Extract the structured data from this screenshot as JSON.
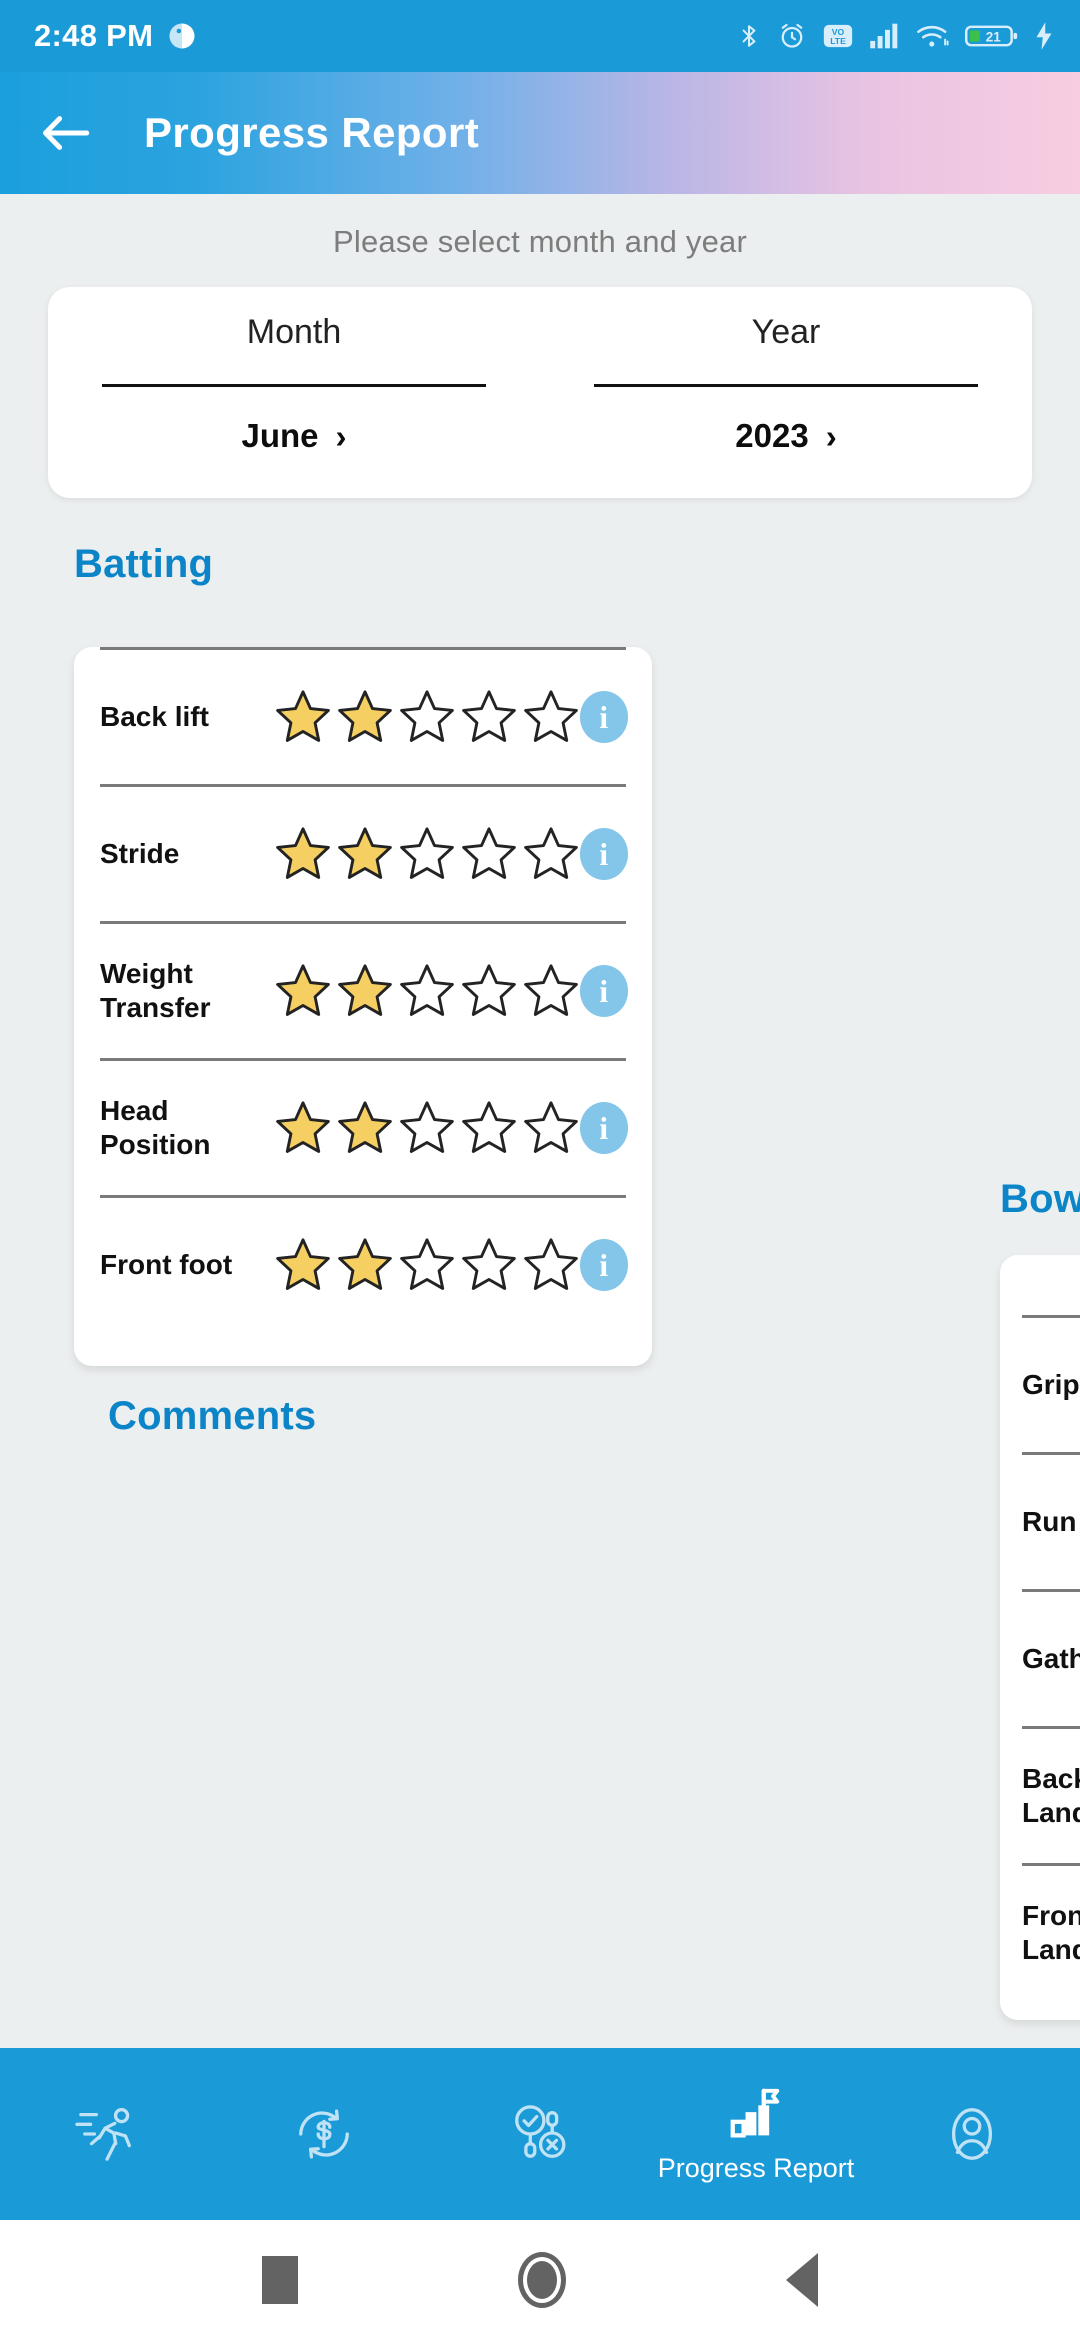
{
  "status_bar": {
    "time": "2:48 PM",
    "left_icons": [
      "weather-icon"
    ],
    "right_icons": [
      "bluetooth-icon",
      "alarm-icon",
      "volte-icon",
      "signal-icon",
      "wifi-icon",
      "battery-icon",
      "charging-icon"
    ],
    "battery_percent": "21"
  },
  "app_bar": {
    "back_icon": "arrow-left-icon",
    "title": "Progress Report",
    "gradient_start": "#1ba0dd",
    "gradient_end": "#f8cde1"
  },
  "picker": {
    "hint": "Please select month and year",
    "month": {
      "label": "Month",
      "value": "June",
      "chevron": "›"
    },
    "year": {
      "label": "Year",
      "value": "2023",
      "chevron": "›"
    }
  },
  "sections": [
    {
      "title": "Batting",
      "accent": "#0b85c8",
      "rows": [
        {
          "name": "Back lift",
          "rating": 2,
          "max": 5,
          "info": "i"
        },
        {
          "name": "Stride",
          "rating": 2,
          "max": 5,
          "info": "i"
        },
        {
          "name": "Weight Transfer",
          "rating": 2,
          "max": 5,
          "info": "i"
        },
        {
          "name": "Head Position",
          "rating": 2,
          "max": 5,
          "info": "i"
        },
        {
          "name": "Front foot",
          "rating": 2,
          "max": 5,
          "info": "i"
        }
      ]
    }
  ],
  "peek_section": {
    "title": "Bowling",
    "rows": [
      {
        "name": "Grip"
      },
      {
        "name": "Run up"
      },
      {
        "name": "Gather"
      },
      {
        "name": "Back foot Landing"
      },
      {
        "name": "Front foot Landing"
      }
    ]
  },
  "comments": {
    "title": "Comments"
  },
  "bottom_nav": {
    "items": [
      {
        "icon": "running-icon",
        "label": "",
        "active": false
      },
      {
        "icon": "dollar-refresh-icon",
        "label": "",
        "active": false
      },
      {
        "icon": "select-check-icon",
        "label": "",
        "active": false
      },
      {
        "icon": "progress-chart-icon",
        "label": "Progress Report",
        "active": true
      },
      {
        "icon": "user-avatar-icon",
        "label": "",
        "active": false
      }
    ],
    "background": "#1b9ad8"
  },
  "system_nav": {
    "recents": "square-icon",
    "home": "circle-icon",
    "back": "triangle-back-icon"
  },
  "colors": {
    "star_filled": "#f6cf62",
    "star_empty": "#ffffff",
    "star_stroke": "#232323",
    "info_bg": "#83c6e9",
    "page_bg": "#eceff0"
  }
}
